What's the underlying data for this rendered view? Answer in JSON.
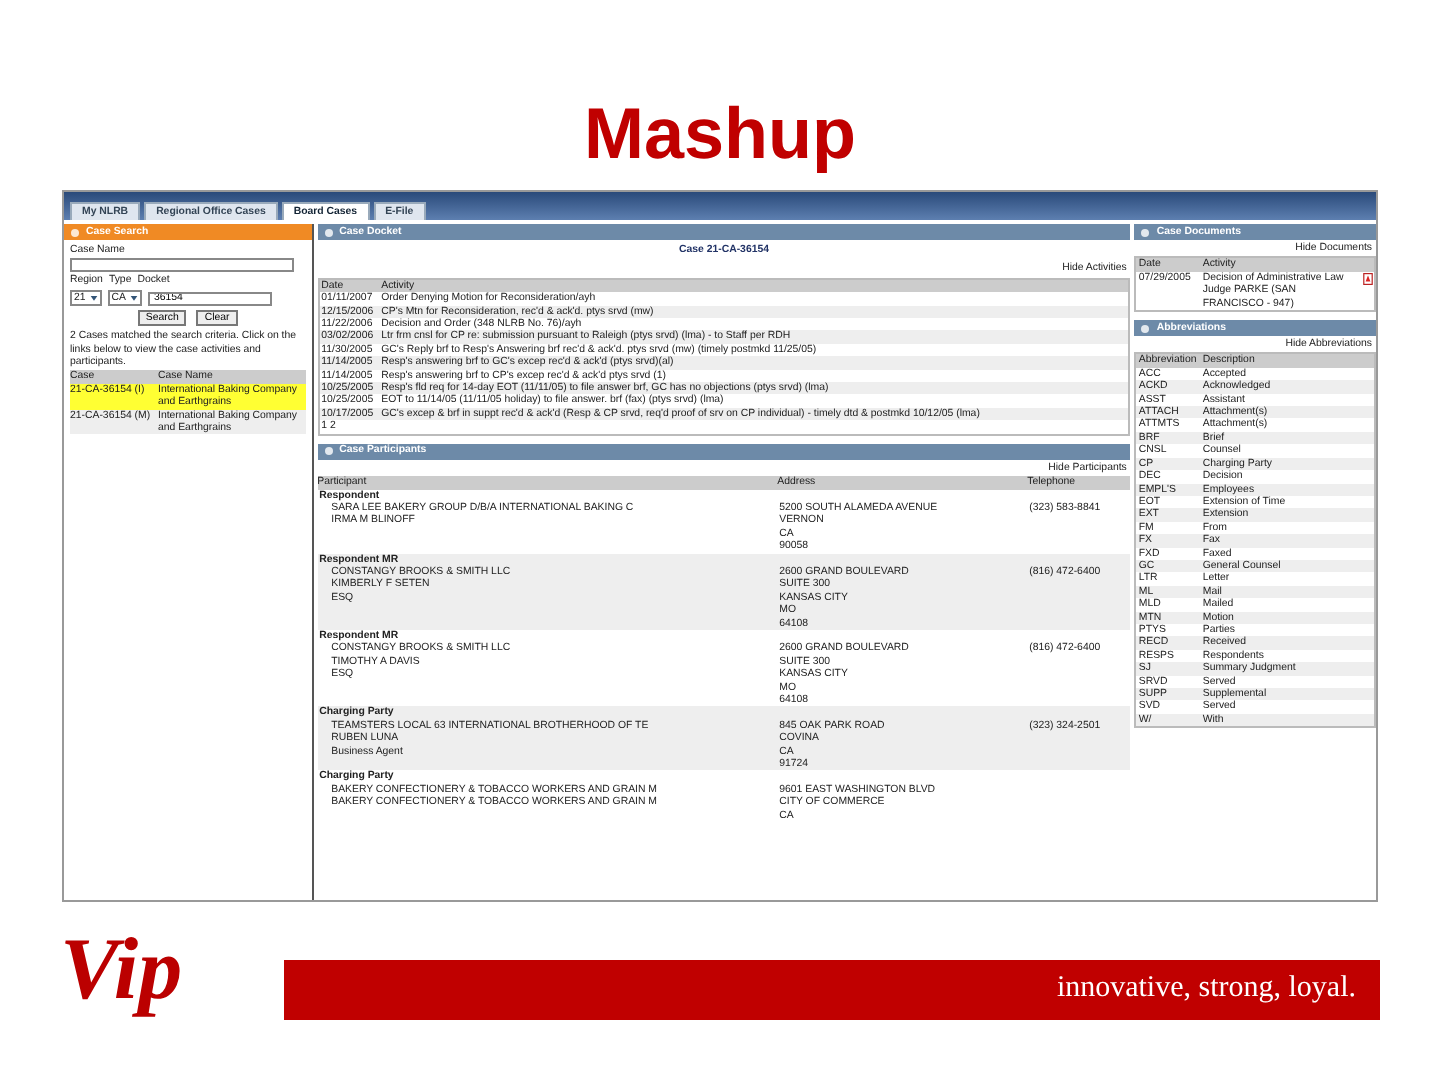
{
  "slide_title": "Mashup",
  "tabs": [
    {
      "label": "My NLRB",
      "selected": false
    },
    {
      "label": "Regional Office Cases",
      "selected": false
    },
    {
      "label": "Board Cases",
      "selected": true
    },
    {
      "label": "E-File",
      "selected": false
    }
  ],
  "case_search": {
    "title": "Case Search",
    "case_name_label": "Case Name",
    "region_label": "Region",
    "type_label": "Type",
    "docket_label": "Docket",
    "region": "21",
    "type": "CA",
    "docket": "36154",
    "buttons": [
      "Search",
      "Clear"
    ],
    "message": "2 Cases matched the search criteria. Click on the links below to view the case activities and participants.",
    "columns": [
      "Case",
      "Case Name"
    ],
    "rows": [
      {
        "case": "21-CA-36154 (I)",
        "name": "International Baking Company and Earthgrains",
        "selected": true
      },
      {
        "case": "21-CA-36154 (M)",
        "name": "International Baking Company and Earthgrains",
        "selected": false
      }
    ]
  },
  "docket": {
    "title": "Case Docket",
    "case_heading": "Case 21-CA-36154",
    "hide_link": "Hide Activities",
    "columns": [
      "Date",
      "Activity"
    ],
    "rows": [
      {
        "date": "01/11/2007",
        "activity": "Order Denying Motion for Reconsideration/ayh"
      },
      {
        "date": "12/15/2006",
        "activity": "CP's Mtn for Reconsideration, rec'd & ack'd. ptys srvd (mw)"
      },
      {
        "date": "11/22/2006",
        "activity": "Decision and Order (348 NLRB No. 76)/ayh"
      },
      {
        "date": "03/02/2006",
        "activity": "Ltr frm cnsl for CP re: submission pursuant to Raleigh (ptys srvd) (lma) - to Staff per RDH"
      },
      {
        "date": "11/30/2005",
        "activity": "GC's Reply brf to Resp's Answering brf rec'd & ack'd. ptys srvd (mw) (timely postmkd 11/25/05)"
      },
      {
        "date": "11/14/2005",
        "activity": "Resp's answering brf to GC's excep rec'd & ack'd (ptys srvd)(al)"
      },
      {
        "date": "11/14/2005",
        "activity": "Resp's answering brf to CP's excep rec'd & ack'd ptys srvd (1)"
      },
      {
        "date": "10/25/2005",
        "activity": "Resp's fld req for 14-day EOT (11/11/05) to file answer brf, GC has no objections (ptys srvd) (lma)"
      },
      {
        "date": "10/25/2005",
        "activity": "EOT to 11/14/05 (11/11/05 holiday) to file answer. brf (fax) (ptys srvd) (lma)"
      },
      {
        "date": "10/17/2005",
        "activity": "GC's excep & brf in suppt rec'd & ack'd (Resp & CP srvd, req'd proof of srv on CP individual) - timely dtd & postmkd 10/12/05 (lma)"
      }
    ],
    "pager": "1 2"
  },
  "participants": {
    "title": "Case Participants",
    "hide_link": "Hide Participants",
    "columns": [
      "Participant",
      "Address",
      "Telephone"
    ],
    "groups": [
      {
        "role": "Respondent",
        "names": [
          "SARA LEE BAKERY GROUP D/B/A INTERNATIONAL BAKING C",
          "IRMA M BLINOFF"
        ],
        "address": [
          "5200 SOUTH ALAMEDA AVENUE",
          "VERNON",
          "CA",
          "90058"
        ],
        "telephone": "(323) 583-8841"
      },
      {
        "role": "Respondent MR",
        "names": [
          "CONSTANGY BROOKS & SMITH LLC",
          "KIMBERLY F SETEN",
          "ESQ"
        ],
        "address": [
          "2600 GRAND BOULEVARD",
          "SUITE 300",
          "KANSAS CITY",
          "MO",
          "64108"
        ],
        "telephone": "(816) 472-6400"
      },
      {
        "role": "Respondent MR",
        "names": [
          "CONSTANGY BROOKS & SMITH LLC",
          "TIMOTHY A DAVIS",
          "ESQ"
        ],
        "address": [
          "2600 GRAND BOULEVARD",
          "SUITE 300",
          "KANSAS CITY",
          "MO",
          "64108"
        ],
        "telephone": "(816) 472-6400"
      },
      {
        "role": "Charging Party",
        "names": [
          "TEAMSTERS LOCAL 63 INTERNATIONAL BROTHERHOOD OF TE",
          "RUBEN LUNA",
          "Business Agent"
        ],
        "address": [
          "845 OAK PARK ROAD",
          "COVINA",
          "CA",
          "91724"
        ],
        "telephone": "(323) 324-2501"
      },
      {
        "role": "Charging Party",
        "names": [
          "BAKERY CONFECTIONERY & TOBACCO WORKERS AND GRAIN M",
          "BAKERY CONFECTIONERY & TOBACCO WORKERS AND GRAIN M"
        ],
        "address": [
          "9601 EAST WASHINGTON BLVD",
          "CITY OF COMMERCE",
          "CA"
        ]
      }
    ]
  },
  "documents": {
    "title": "Case Documents",
    "hide_link": "Hide Documents",
    "columns": [
      "Date",
      "Activity"
    ],
    "rows": [
      {
        "date": "07/29/2005",
        "activity": "Decision of Administrative Law Judge PARKE (SAN FRANCISCO - 947)"
      }
    ]
  },
  "abbreviations": {
    "title": "Abbreviations",
    "hide_link": "Hide Abbreviations",
    "columns": [
      "Abbreviation",
      "Description"
    ],
    "rows": [
      {
        "abbr": "ACC",
        "desc": "Accepted"
      },
      {
        "abbr": "ACKD",
        "desc": "Acknowledged"
      },
      {
        "abbr": "ASST",
        "desc": "Assistant"
      },
      {
        "abbr": "ATTACH",
        "desc": "Attachment(s)"
      },
      {
        "abbr": "ATTMTS",
        "desc": "Attachment(s)"
      },
      {
        "abbr": "BRF",
        "desc": "Brief"
      },
      {
        "abbr": "CNSL",
        "desc": "Counsel"
      },
      {
        "abbr": "CP",
        "desc": "Charging Party"
      },
      {
        "abbr": "DEC",
        "desc": "Decision"
      },
      {
        "abbr": "EMPL'S",
        "desc": "Employees"
      },
      {
        "abbr": "EOT",
        "desc": "Extension of Time"
      },
      {
        "abbr": "EXT",
        "desc": "Extension"
      },
      {
        "abbr": "FM",
        "desc": "From"
      },
      {
        "abbr": "FX",
        "desc": "Fax"
      },
      {
        "abbr": "FXD",
        "desc": "Faxed"
      },
      {
        "abbr": "GC",
        "desc": "General Counsel"
      },
      {
        "abbr": "LTR",
        "desc": "Letter"
      },
      {
        "abbr": "ML",
        "desc": "Mail"
      },
      {
        "abbr": "MLD",
        "desc": "Mailed"
      },
      {
        "abbr": "MTN",
        "desc": "Motion"
      },
      {
        "abbr": "PTYS",
        "desc": "Parties"
      },
      {
        "abbr": "RECD",
        "desc": "Received"
      },
      {
        "abbr": "RESPS",
        "desc": "Respondents"
      },
      {
        "abbr": "SJ",
        "desc": "Summary Judgment"
      },
      {
        "abbr": "SRVD",
        "desc": "Served"
      },
      {
        "abbr": "SUPP",
        "desc": "Supplemental"
      },
      {
        "abbr": "SVD",
        "desc": "Served"
      },
      {
        "abbr": "W/",
        "desc": "With"
      }
    ]
  },
  "footer": {
    "logo": "Vip",
    "tagline": "innovative, strong, loyal."
  }
}
